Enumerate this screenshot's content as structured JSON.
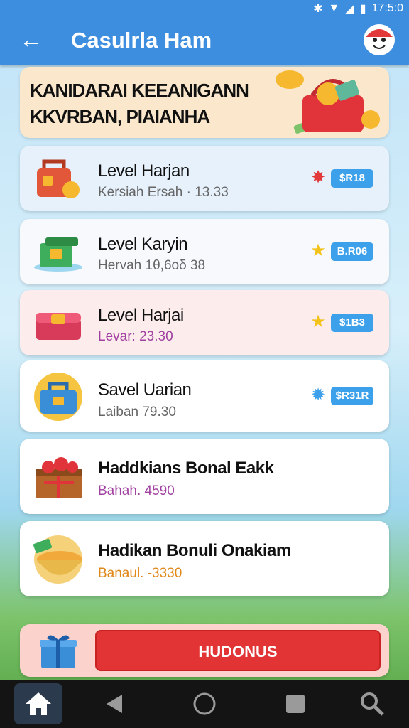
{
  "status_bar": {
    "time": "17:5:0"
  },
  "app_bar": {
    "title": "Casulrla Ham",
    "back_icon": "arrow-left-icon",
    "avatar_icon": "face-icon"
  },
  "banner": {
    "line1": "KANIDARAI KEEANIGANN",
    "line2": "KKVRBAN, PIAIANHA"
  },
  "items": [
    {
      "title": "Level Harjan",
      "subtitle": "Kersiah Ersah · 13.33",
      "badge": "$R18",
      "icon": "lunchbox-icon",
      "star_color": "#e23a3a"
    },
    {
      "title": "Level Karyin",
      "subtitle": "Hervah 1θ,6οδ 38",
      "badge": "B.R06",
      "icon": "cash-box-icon",
      "star_color": "#f3c21b"
    },
    {
      "title": "Level Harjai",
      "subtitle": "Levar: 23.30",
      "badge": "$1B3",
      "icon": "treasure-box-icon",
      "star_color": "#f3c21b"
    },
    {
      "title": "Savel Uarian",
      "subtitle": "Laiban 79.30",
      "badge": "$R31R",
      "icon": "coin-case-icon",
      "star_color": "#3ca0ea"
    },
    {
      "title": "Haddkians Bonal Eakk",
      "subtitle": "Bahah.   4590",
      "badge": "",
      "icon": "gift-basket-icon"
    },
    {
      "title": "Hadikan Bonuli Onakiam",
      "subtitle": "Banaul. -3330",
      "badge": "",
      "icon": "gold-bowl-icon"
    }
  ],
  "cta": {
    "label": "HUDONUS",
    "icon": "gift-box-icon"
  },
  "nav": {
    "home": "home-icon",
    "back": "back-triangle-icon",
    "circle": "home-circle-icon",
    "recents": "recents-square-icon",
    "search": "search-icon"
  },
  "colors": {
    "appbar": "#3e8ee0",
    "badge": "#3ca0ea",
    "cta": "#e23434"
  }
}
